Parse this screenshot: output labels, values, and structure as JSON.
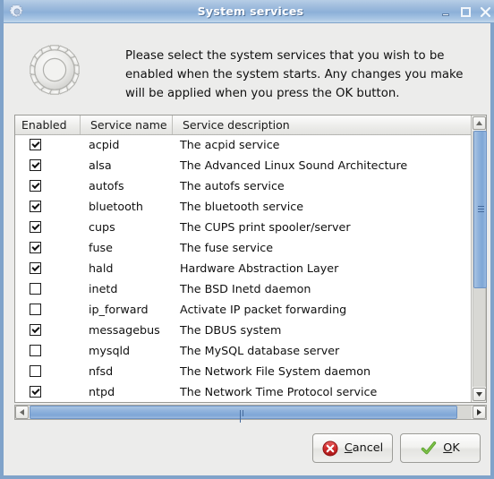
{
  "window": {
    "title": "System services",
    "icon": "gear-icon",
    "buttons": {
      "minimize": "minimize-icon",
      "maximize": "maximize-icon",
      "close": "close-icon"
    },
    "border_color": "#80a3ca",
    "background_color": "#ececeb"
  },
  "header": {
    "icon": "gear-icon",
    "message": "Please select the system services that you wish to be enabled when the system starts. Any changes you make will be applied when you press the OK button."
  },
  "table": {
    "columns": [
      "Enabled",
      "Service name",
      "Service description"
    ],
    "rows": [
      {
        "enabled": true,
        "name": "acpid",
        "description": "The acpid service"
      },
      {
        "enabled": true,
        "name": "alsa",
        "description": "The Advanced Linux Sound Architecture"
      },
      {
        "enabled": true,
        "name": "autofs",
        "description": "The autofs service"
      },
      {
        "enabled": true,
        "name": "bluetooth",
        "description": "The bluetooth service"
      },
      {
        "enabled": true,
        "name": "cups",
        "description": "The CUPS print spooler/server"
      },
      {
        "enabled": true,
        "name": "fuse",
        "description": "The fuse service"
      },
      {
        "enabled": true,
        "name": "hald",
        "description": "Hardware Abstraction Layer"
      },
      {
        "enabled": false,
        "name": "inetd",
        "description": "The BSD Inetd daemon"
      },
      {
        "enabled": false,
        "name": "ip_forward",
        "description": "Activate IP packet forwarding"
      },
      {
        "enabled": true,
        "name": "messagebus",
        "description": "The DBUS system"
      },
      {
        "enabled": false,
        "name": "mysqld",
        "description": "The MySQL database server"
      },
      {
        "enabled": false,
        "name": "nfsd",
        "description": "The Network File System daemon"
      },
      {
        "enabled": true,
        "name": "ntpd",
        "description": "The Network Time Protocol service"
      }
    ]
  },
  "scrollbars": {
    "vertical": {
      "up_icon": "chevron-up-icon",
      "down_icon": "chevron-down-icon",
      "thumb_color": "#8fb2dc"
    },
    "horizontal": {
      "left_icon": "chevron-left-icon",
      "right_icon": "chevron-right-icon",
      "thumb_color": "#8fb2dc"
    }
  },
  "footer": {
    "cancel": {
      "label_prefix": "",
      "mnemonic": "C",
      "label_suffix": "ancel",
      "icon": "error-x-icon",
      "icon_color": "#cc2222"
    },
    "ok": {
      "label_prefix": "",
      "mnemonic": "O",
      "label_suffix": "K",
      "icon": "check-icon",
      "icon_color": "#5aa02c"
    }
  }
}
